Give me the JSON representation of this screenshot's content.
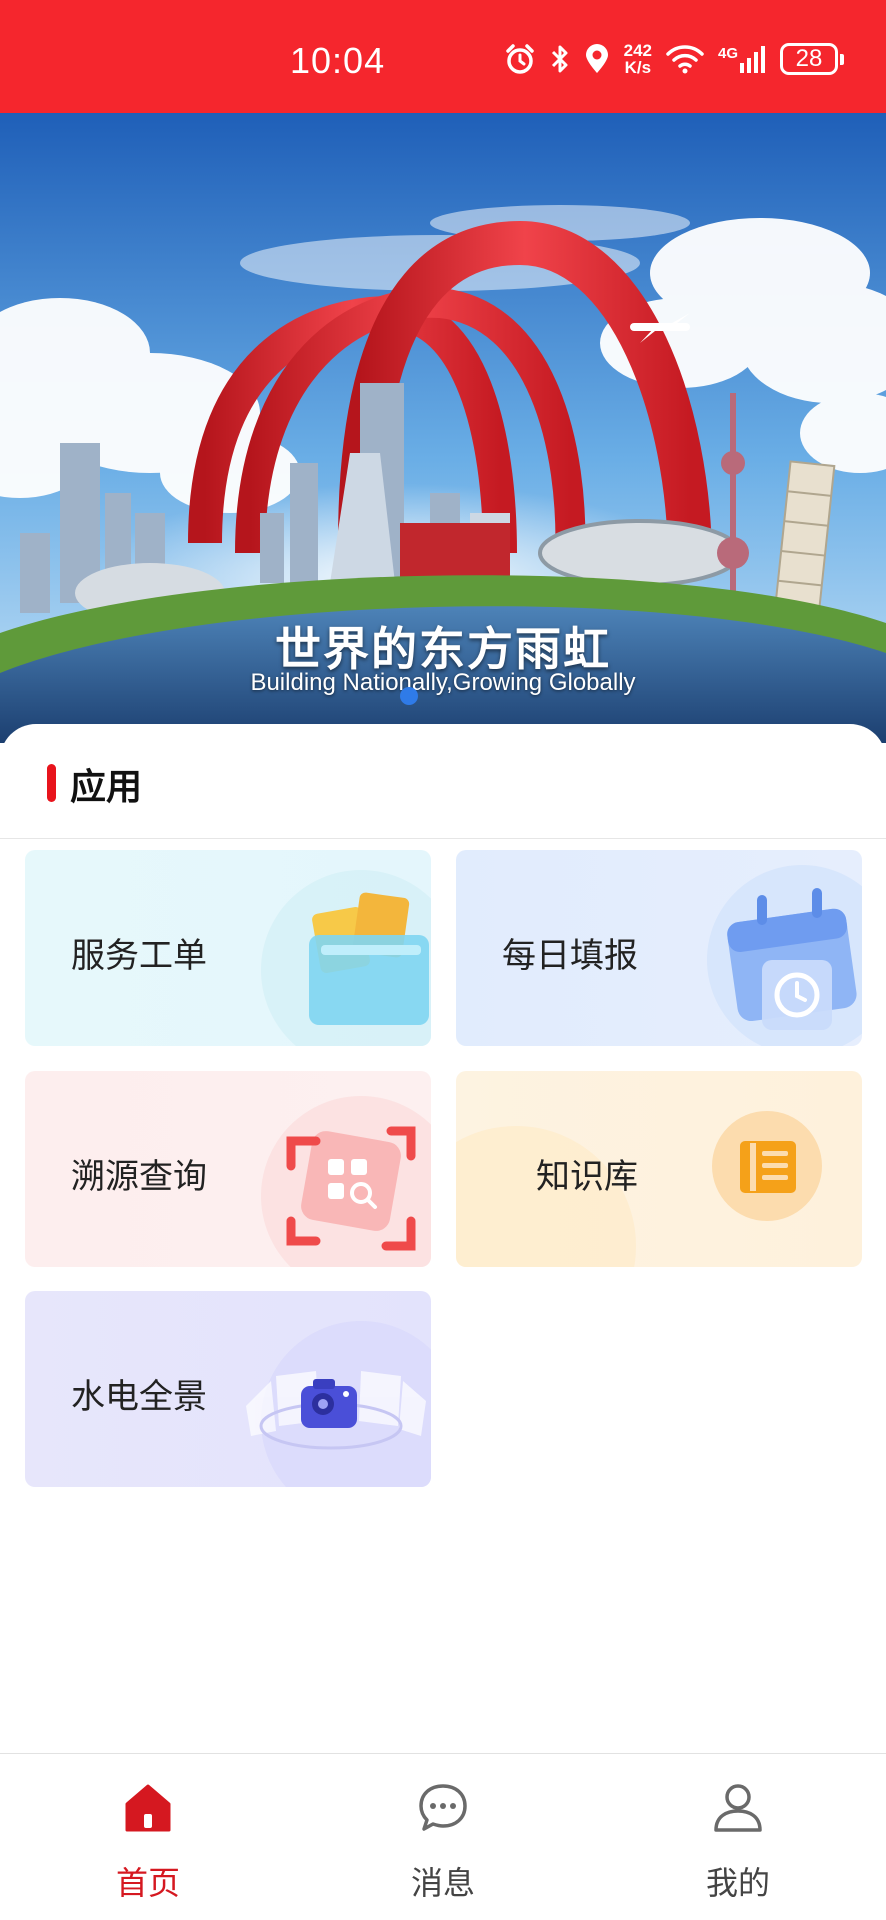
{
  "status_bar": {
    "time": "10:04",
    "net_speed_top": "242",
    "net_speed_bottom": "K/s",
    "network": "4G",
    "battery": "28",
    "icons": [
      "alarm-icon",
      "bluetooth-icon",
      "location-icon",
      "wifi-icon",
      "signal-icon",
      "battery-icon"
    ]
  },
  "banner": {
    "title": "世界的东方雨虹",
    "subtitle": "Building Nationally,Growing Globally"
  },
  "apps_section": {
    "title": "应用",
    "tiles": [
      {
        "label": "服务工单",
        "icon": "folder-icon"
      },
      {
        "label": "每日填报",
        "icon": "calendar-clock-icon"
      },
      {
        "label": "溯源查询",
        "icon": "qr-scan-icon"
      },
      {
        "label": "知识库",
        "icon": "notebook-icon"
      },
      {
        "label": "水电全景",
        "icon": "panorama-camera-icon"
      }
    ]
  },
  "bottom_nav": {
    "items": [
      {
        "label": "首页",
        "icon": "home-icon",
        "active": true
      },
      {
        "label": "消息",
        "icon": "chat-icon",
        "active": false
      },
      {
        "label": "我的",
        "icon": "user-icon",
        "active": false
      }
    ]
  },
  "colors": {
    "brand_red": "#f5262d",
    "active_nav": "#d51820",
    "indicator_blue": "#2f7be8"
  }
}
